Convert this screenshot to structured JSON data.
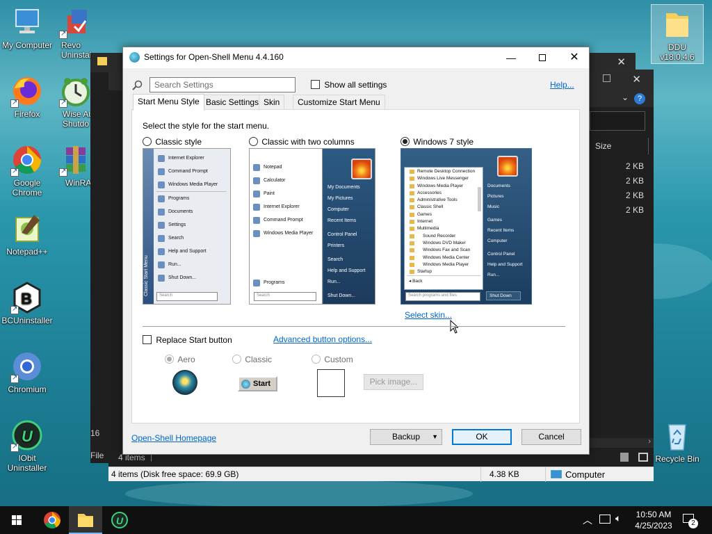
{
  "desktop_icons": [
    {
      "name": "my-computer",
      "label": "My Computer"
    },
    {
      "name": "revo-uninstaller",
      "label": "Revo Uninstal"
    },
    {
      "name": "firefox",
      "label": "Firefox"
    },
    {
      "name": "wise-auto-shutdown",
      "label": "Wise Au Shutdo"
    },
    {
      "name": "google-chrome",
      "label": "Google Chrome"
    },
    {
      "name": "winrar",
      "label": "WinRA"
    },
    {
      "name": "notepad-plus-plus",
      "label": "Notepad++"
    },
    {
      "name": "bcuninstaller",
      "label": "BCUninstaller"
    },
    {
      "name": "chromium",
      "label": "Chromium"
    },
    {
      "name": "iobit-uninstaller",
      "label": "IObit Uninstaller"
    },
    {
      "name": "ddu",
      "label": "DDU v18.0.4.6"
    },
    {
      "name": "recycle-bin",
      "label": "Recycle Bin"
    }
  ],
  "explorer": {
    "size_header": "Size",
    "sizes": [
      "2 KB",
      "2 KB",
      "2 KB",
      "2 KB"
    ],
    "items_count": "4 items",
    "partial_left_1": "16",
    "partial_left_2": "File",
    "status_left": "4 items (Disk free space: 69.9 GB)",
    "status_size": "4.38 KB",
    "status_location": "Computer"
  },
  "dialog": {
    "title": "Settings for Open-Shell Menu 4.4.160",
    "search_placeholder": "Search Settings",
    "show_all": "Show all settings",
    "help": "Help...",
    "tabs": [
      "Start Menu Style",
      "Basic Settings",
      "Skin",
      "Customize Start Menu"
    ],
    "instruction": "Select the style for the start menu.",
    "styles": [
      {
        "label": "Classic style",
        "selected": false
      },
      {
        "label": "Classic with two columns",
        "selected": false
      },
      {
        "label": "Windows 7 style",
        "selected": true
      }
    ],
    "classic_items": [
      "Internet Explorer",
      "Command Prompt",
      "Windows Media Player",
      "Programs",
      "Documents",
      "Settings",
      "Search",
      "Help and Support",
      "Run...",
      "Shut Down..."
    ],
    "classic_side": "Classic Start Menu",
    "search_label": "Search",
    "two_col_left": [
      "Notepad",
      "Calculator",
      "Paint",
      "Internet Explorer",
      "Command Prompt",
      "Windows Media Player"
    ],
    "two_col_programs": "Programs",
    "two_col_right": [
      "My Documents",
      "My Pictures",
      "Computer",
      "Recent Items",
      "Control Panel",
      "Printers",
      "Search",
      "Help and Support",
      "Run...",
      "Shut Down..."
    ],
    "win7_tree": [
      "Remote Desktop Connection",
      "Windows Live Messenger",
      "Windows Media Player",
      "Accessories",
      "Administrative Tools",
      "Classic Shell",
      "Games",
      "Internet",
      "Multimedia",
      "Sound Recorder",
      "Windows DVD Maker",
      "Windows Fax and Scan",
      "Windows Media Center",
      "Windows Media Player",
      "Startup"
    ],
    "win7_back": "Back",
    "win7_search": "Search programs and files",
    "win7_right": [
      "Documents",
      "Pictures",
      "Music",
      "Games",
      "Recent Items",
      "Computer",
      "Control Panel",
      "Help and Support",
      "Run..."
    ],
    "win7_shutdown": "Shut Down",
    "select_skin": "Select skin...",
    "replace_start": "Replace Start button",
    "advanced_button": "Advanced button options...",
    "button_styles": [
      "Aero",
      "Classic",
      "Custom"
    ],
    "start_label": "Start",
    "pick_image": "Pick image...",
    "homepage": "Open-Shell Homepage",
    "backup": "Backup",
    "ok": "OK",
    "cancel": "Cancel"
  },
  "taskbar": {
    "time": "10:50 AM",
    "date": "4/25/2023",
    "notification_count": "2"
  }
}
